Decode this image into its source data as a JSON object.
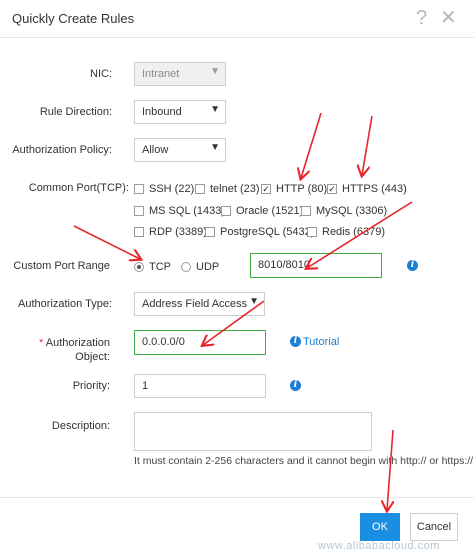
{
  "dialog": {
    "title": "Quickly Create Rules",
    "help_icon": "question-icon",
    "close_icon": "close-icon"
  },
  "form": {
    "nic": {
      "label": "NIC:",
      "value": "Intranet"
    },
    "rule_direction": {
      "label": "Rule Direction:",
      "value": "Inbound"
    },
    "authorization_policy": {
      "label": "Authorization Policy:",
      "value": "Allow"
    },
    "common_port": {
      "label": "Common Port(TCP):",
      "options": [
        {
          "label": "SSH (22)",
          "checked": false
        },
        {
          "label": "telnet (23)",
          "checked": false
        },
        {
          "label": "HTTP (80)",
          "checked": true
        },
        {
          "label": "HTTPS (443)",
          "checked": true
        },
        {
          "label": "MS SQL (1433)",
          "checked": false
        },
        {
          "label": "Oracle (1521)",
          "checked": false
        },
        {
          "label": "MySQL (3306)",
          "checked": false
        },
        {
          "label": "RDP (3389)",
          "checked": false
        },
        {
          "label": "PostgreSQL (5432)",
          "checked": false
        },
        {
          "label": "Redis (6379)",
          "checked": false
        }
      ]
    },
    "custom_port_range": {
      "label": "Custom Port Range",
      "tcp_label": "TCP",
      "udp_label": "UDP",
      "selected": "TCP",
      "value": "8010/8010"
    },
    "authorization_type": {
      "label": "Authorization Type:",
      "value": "Address Field Access"
    },
    "authorization_object": {
      "required_mark": "*",
      "label_line1": "Authorization",
      "label_line2": "Object:",
      "value": "0.0.0.0/0",
      "tutorial_link": "Tutorial"
    },
    "priority": {
      "label": "Priority:",
      "value": "1"
    },
    "description": {
      "label": "Description:",
      "value": "",
      "hint": "It must contain 2-256 characters and it cannot begin with http:// or https://"
    }
  },
  "footer": {
    "ok_label": "OK",
    "cancel_label": "Cancel"
  },
  "watermark": "www.alibabacloud.com",
  "colors": {
    "primary": "#1a8ee0",
    "highlight_border": "#3fae49",
    "annotation_arrow": "#e8252b",
    "required": "#e8363b",
    "info": "#1a7fd4"
  }
}
